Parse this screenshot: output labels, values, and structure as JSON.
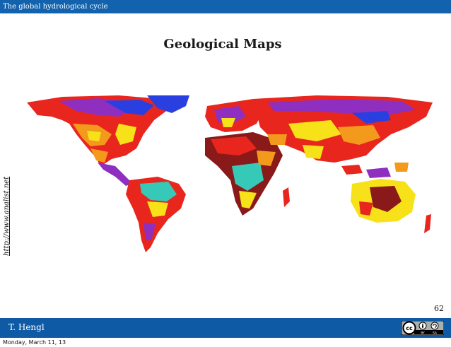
{
  "header": {
    "title": "The global hydrological cycle"
  },
  "slide": {
    "title": "Geological Maps",
    "side_credit": "http://www.analist.net",
    "page_number": "62"
  },
  "footer": {
    "author": "T. Hengl",
    "license_icon": "cc-by-sa-icon",
    "license_text_cc": "cc",
    "license_text_by": "BY",
    "license_text_sa": "SA"
  },
  "timestamp": "Monday, March 11, 13",
  "colors": {
    "bar": "#1262ad",
    "bottom_bar": "#0e5aa5",
    "map_red": "#e8261e",
    "map_yellow": "#f7e21a",
    "map_orange": "#f39a1c",
    "map_purple": "#8e2fc0",
    "map_blue": "#2a3fe0",
    "map_teal": "#37c9b8",
    "map_maroon": "#8a1a1a"
  }
}
